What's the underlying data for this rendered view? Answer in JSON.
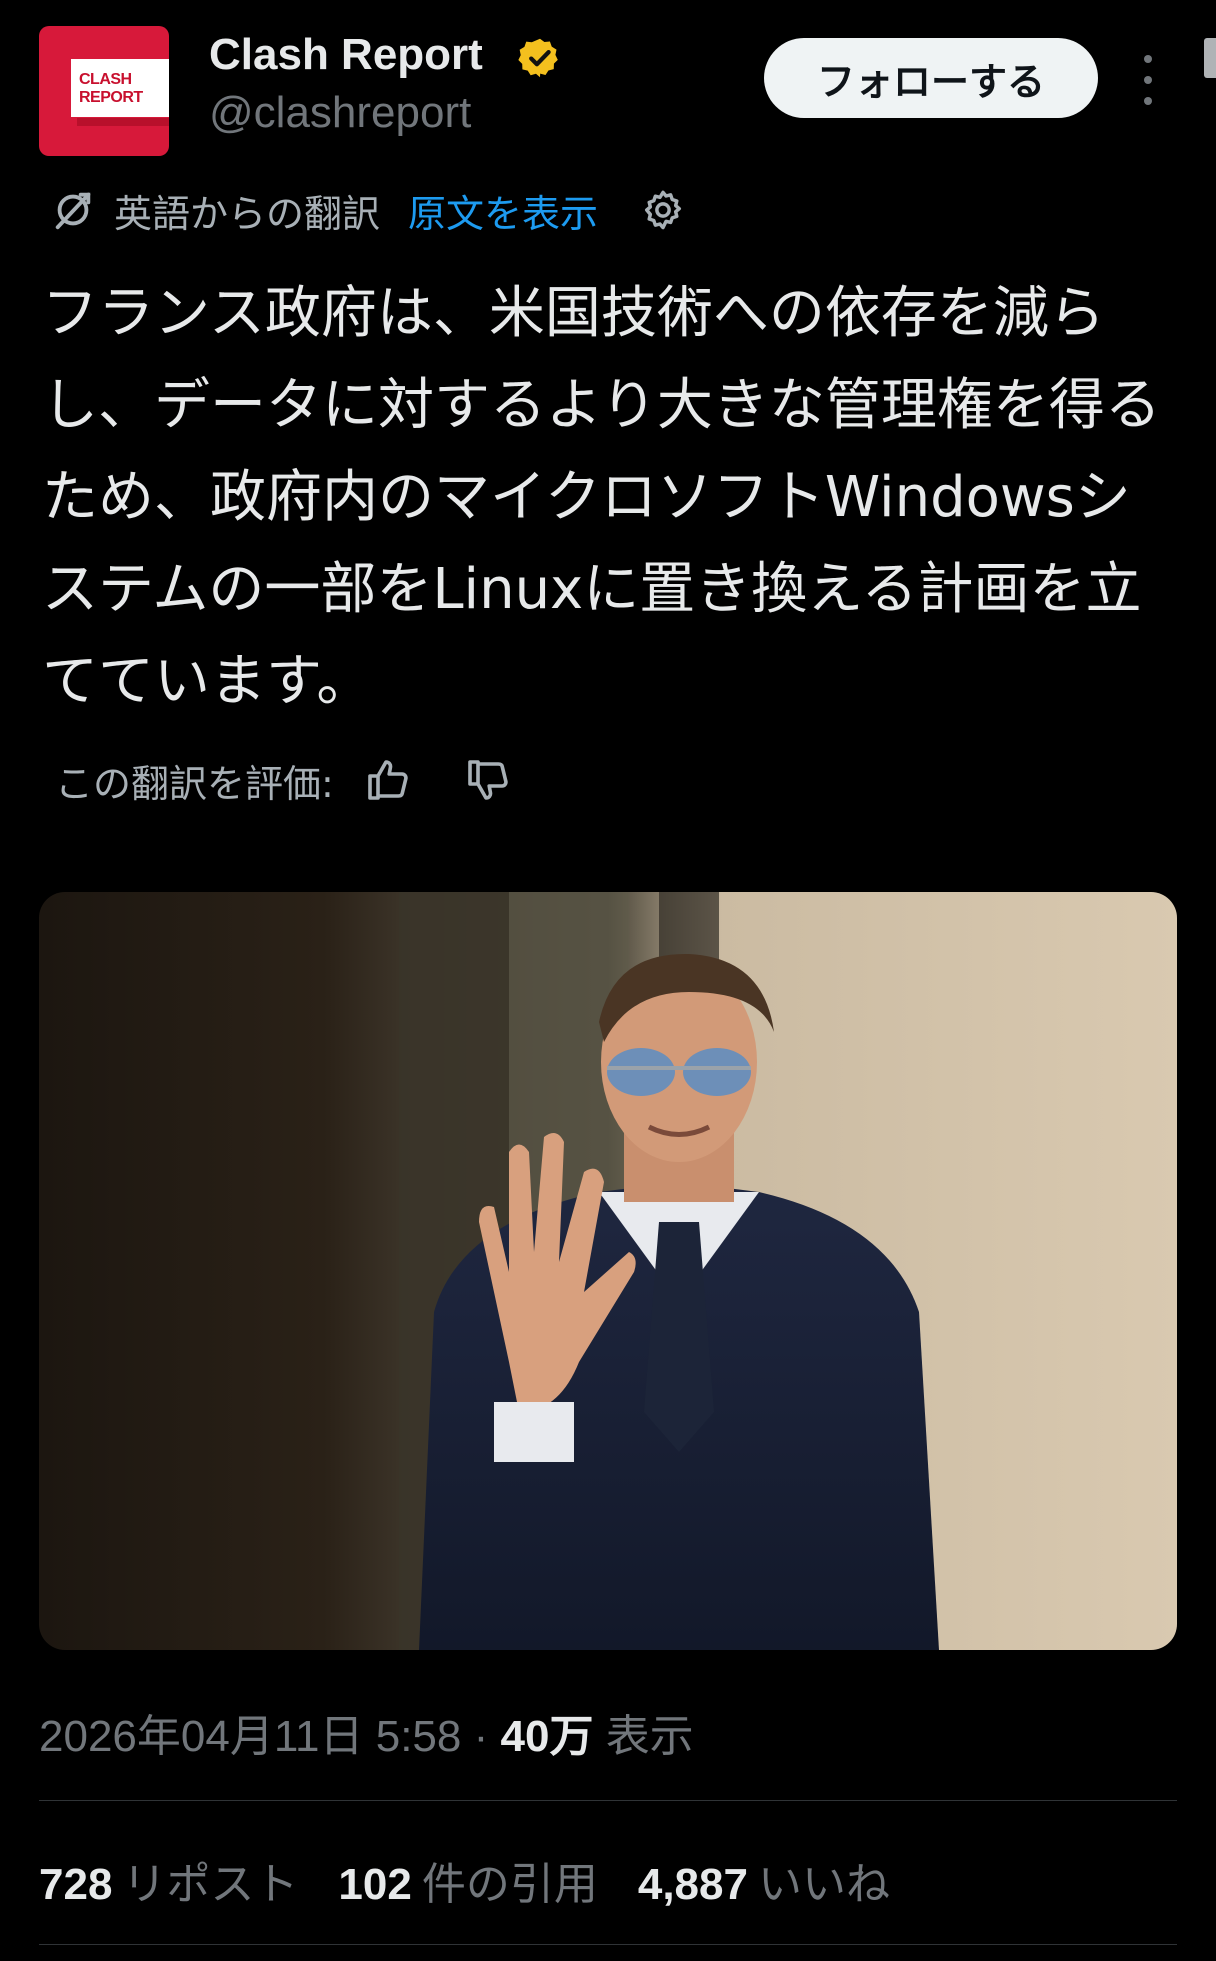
{
  "author": {
    "avatar_text_line1": "CLASH",
    "avatar_text_line2": "REPORT",
    "name": "Clash Report",
    "handle": "@clashreport",
    "verified_icon": "verified-badge-icon"
  },
  "actions": {
    "follow_label": "フォローする",
    "more_icon": "more-options-icon"
  },
  "translation": {
    "label": "英語からの翻訳",
    "show_original": "原文を表示",
    "settings_icon": "gear-icon",
    "rate_label": "この翻訳を評価:"
  },
  "post": {
    "text": "フランス政府は、米国技術への依存を減らし、データに対するより大きな管理権を得るため、政府内のマイクロソフトWindowsシステムの一部をLinuxに置き換える計画を立てています。"
  },
  "meta": {
    "date": "2026年04月11日 5:58",
    "separator": "·",
    "views_count": "40万",
    "views_label": "表示"
  },
  "stats": {
    "reposts_count": "728",
    "reposts_label": "リポスト",
    "quotes_count": "102",
    "quotes_label": "件の引用",
    "likes_count": "4,887",
    "likes_label": "いいね"
  },
  "colors": {
    "background": "#000000",
    "link": "#1d9bf0",
    "badge": "#f4c01e",
    "muted": "#71767b"
  }
}
